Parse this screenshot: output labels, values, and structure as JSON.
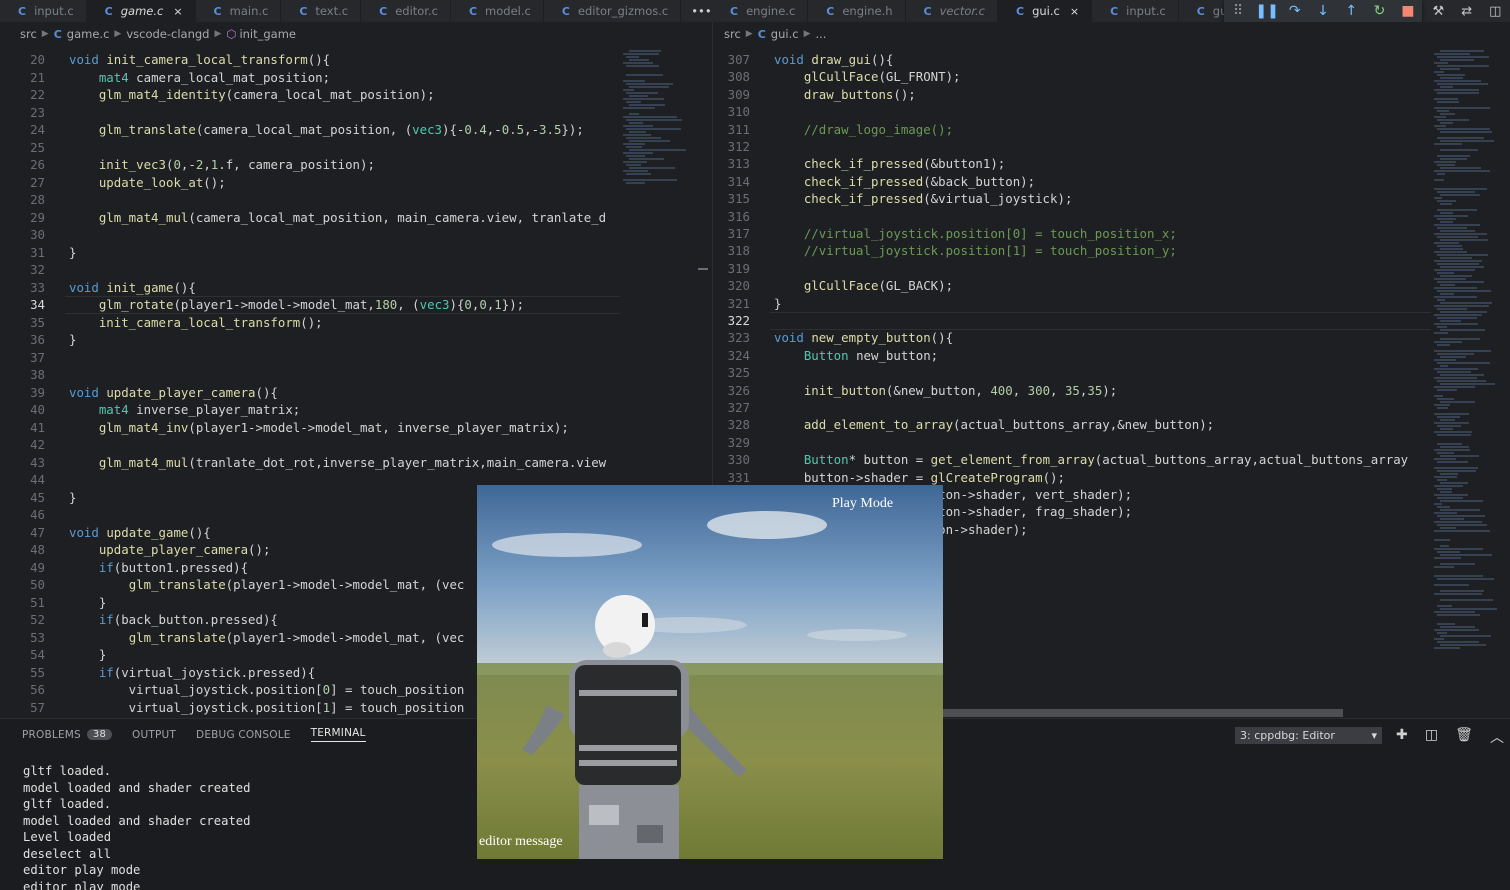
{
  "left_tabs": [
    {
      "label": "input.c",
      "active": false,
      "italic": false
    },
    {
      "label": "game.c",
      "active": true,
      "italic": true,
      "close": "×"
    },
    {
      "label": "main.c",
      "active": false,
      "italic": false
    },
    {
      "label": "text.c",
      "active": false,
      "italic": false
    },
    {
      "label": "editor.c",
      "active": false,
      "italic": false
    },
    {
      "label": "model.c",
      "active": false,
      "italic": false
    },
    {
      "label": "editor_gizmos.c",
      "active": false,
      "italic": false
    }
  ],
  "left_more": "•••",
  "right_tabs": [
    {
      "label": "engine.c",
      "active": false,
      "italic": false
    },
    {
      "label": "engine.h",
      "active": false,
      "italic": false
    },
    {
      "label": "vector.c",
      "active": false,
      "italic": true
    },
    {
      "label": "gui.c",
      "active": true,
      "italic": false,
      "close": "×"
    },
    {
      "label": "input.c",
      "active": false,
      "italic": false
    },
    {
      "label": "gu",
      "active": false,
      "italic": false
    }
  ],
  "tab_icon": "C",
  "left_breadcrumb": {
    "folder": "src",
    "file": "game.c",
    "symbol1": "vscode-clangd",
    "symbol2": "init_game"
  },
  "right_breadcrumb": {
    "folder": "src",
    "file": "gui.c",
    "more": "..."
  },
  "left_code": [
    {
      "n": "20",
      "t": "void init_camera_local_transform(){"
    },
    {
      "n": "21",
      "t": "    mat4 camera_local_mat_position;"
    },
    {
      "n": "22",
      "t": "    glm_mat4_identity(camera_local_mat_position);"
    },
    {
      "n": "23",
      "t": ""
    },
    {
      "n": "24",
      "t": "    glm_translate(camera_local_mat_position, (vec3){-0.4,-0.5,-3.5});"
    },
    {
      "n": "25",
      "t": ""
    },
    {
      "n": "26",
      "t": "    init_vec3(0,-2,1.f, camera_position);"
    },
    {
      "n": "27",
      "t": "    update_look_at();"
    },
    {
      "n": "28",
      "t": ""
    },
    {
      "n": "29",
      "t": "    glm_mat4_mul(camera_local_mat_position, main_camera.view, tranlate_d"
    },
    {
      "n": "30",
      "t": ""
    },
    {
      "n": "31",
      "t": "}"
    },
    {
      "n": "32",
      "t": ""
    },
    {
      "n": "33",
      "t": "void init_game(){"
    },
    {
      "n": "34",
      "t": "    glm_rotate(player1->model->model_mat,180, (vec3){0,0,1});"
    },
    {
      "n": "35",
      "t": "    init_camera_local_transform();"
    },
    {
      "n": "36",
      "t": "}"
    },
    {
      "n": "37",
      "t": ""
    },
    {
      "n": "38",
      "t": ""
    },
    {
      "n": "39",
      "t": "void update_player_camera(){"
    },
    {
      "n": "40",
      "t": "    mat4 inverse_player_matrix;"
    },
    {
      "n": "41",
      "t": "    glm_mat4_inv(player1->model->model_mat, inverse_player_matrix);"
    },
    {
      "n": "42",
      "t": ""
    },
    {
      "n": "43",
      "t": "    glm_mat4_mul(tranlate_dot_rot,inverse_player_matrix,main_camera.view"
    },
    {
      "n": "44",
      "t": ""
    },
    {
      "n": "45",
      "t": "}"
    },
    {
      "n": "46",
      "t": ""
    },
    {
      "n": "47",
      "t": "void update_game(){"
    },
    {
      "n": "48",
      "t": "    update_player_camera();"
    },
    {
      "n": "49",
      "t": "    if(button1.pressed){"
    },
    {
      "n": "50",
      "t": "        glm_translate(player1->model->model_mat, (vec"
    },
    {
      "n": "51",
      "t": "    }"
    },
    {
      "n": "52",
      "t": "    if(back_button.pressed){"
    },
    {
      "n": "53",
      "t": "        glm_translate(player1->model->model_mat, (vec"
    },
    {
      "n": "54",
      "t": "    }"
    },
    {
      "n": "55",
      "t": "    if(virtual_joystick.pressed){"
    },
    {
      "n": "56",
      "t": "        virtual_joystick.position[0] = touch_position"
    },
    {
      "n": "57",
      "t": "        virtual_joystick.position[1] = touch_position"
    }
  ],
  "left_current_line": "34",
  "right_code": [
    {
      "n": "307",
      "t": "void draw_gui(){"
    },
    {
      "n": "308",
      "t": "    glCullFace(GL_FRONT);"
    },
    {
      "n": "309",
      "t": "    draw_buttons();"
    },
    {
      "n": "310",
      "t": ""
    },
    {
      "n": "311",
      "t": "    //draw_logo_image();"
    },
    {
      "n": "312",
      "t": ""
    },
    {
      "n": "313",
      "t": "    check_if_pressed(&button1);"
    },
    {
      "n": "314",
      "t": "    check_if_pressed(&back_button);"
    },
    {
      "n": "315",
      "t": "    check_if_pressed(&virtual_joystick);"
    },
    {
      "n": "316",
      "t": ""
    },
    {
      "n": "317",
      "t": "    //virtual_joystick.position[0] = touch_position_x;"
    },
    {
      "n": "318",
      "t": "    //virtual_joystick.position[1] = touch_position_y;"
    },
    {
      "n": "319",
      "t": ""
    },
    {
      "n": "320",
      "t": "    glCullFace(GL_BACK);"
    },
    {
      "n": "321",
      "t": "}"
    },
    {
      "n": "322",
      "t": ""
    },
    {
      "n": "323",
      "t": "void new_empty_button(){"
    },
    {
      "n": "324",
      "t": "    Button new_button;"
    },
    {
      "n": "325",
      "t": ""
    },
    {
      "n": "326",
      "t": "    init_button(&new_button, 400, 300, 35,35);"
    },
    {
      "n": "327",
      "t": ""
    },
    {
      "n": "328",
      "t": "    add_element_to_array(actual_buttons_array,&new_button);"
    },
    {
      "n": "329",
      "t": ""
    },
    {
      "n": "330",
      "t": "    Button* button = get_element_from_array(actual_buttons_array,actual_buttons_array"
    },
    {
      "n": "331",
      "t": "    button->shader = glCreateProgram();"
    },
    {
      "n": "",
      "t": "                     tton->shader, vert_shader);"
    },
    {
      "n": "",
      "t": "                     tton->shader, frag_shader);"
    },
    {
      "n": "",
      "t": "                     ton->shader);"
    }
  ],
  "right_current_line": "322",
  "debug_toolbar": [
    {
      "icon": "grip-icon",
      "glyph": "⠿",
      "color": "#8a8d92"
    },
    {
      "icon": "pause-icon",
      "glyph": "❚❚",
      "color": "#75beff"
    },
    {
      "icon": "step-over-icon",
      "glyph": "↷",
      "color": "#75beff"
    },
    {
      "icon": "step-into-icon",
      "glyph": "↓",
      "color": "#75beff"
    },
    {
      "icon": "step-out-icon",
      "glyph": "↑",
      "color": "#75beff"
    },
    {
      "icon": "restart-icon",
      "glyph": "↻",
      "color": "#89d185"
    },
    {
      "icon": "stop-icon",
      "glyph": "■",
      "color": "#f48771"
    }
  ],
  "editor_actions": [
    {
      "icon": "build-icon",
      "glyph": "⚒"
    },
    {
      "icon": "compare-icon",
      "glyph": "⇄"
    },
    {
      "icon": "split-editor-icon",
      "glyph": "◫"
    }
  ],
  "panel": {
    "tabs": [
      {
        "label": "PROBLEMS",
        "badge": "38",
        "active": false
      },
      {
        "label": "OUTPUT",
        "active": false
      },
      {
        "label": "DEBUG CONSOLE",
        "active": false
      },
      {
        "label": "TERMINAL",
        "active": true
      }
    ],
    "terminal_select": "3: cppdbg: Editor",
    "terminal_lines": [
      "gltf loaded.",
      "model loaded and shader created",
      "gltf loaded.",
      "model loaded and shader created",
      "Level loaded",
      "deselect all",
      "editor play mode",
      "editor play mode"
    ]
  },
  "game_window": {
    "mode_label": "Play Mode",
    "message": "editor message"
  },
  "colors": {
    "accent": "#5a8fd6",
    "background": "#1e1f22",
    "keyword": "#569cd6",
    "type": "#4ec9b0",
    "function": "#dcdcaa",
    "number": "#b5cea8",
    "comment": "#6a9955"
  }
}
